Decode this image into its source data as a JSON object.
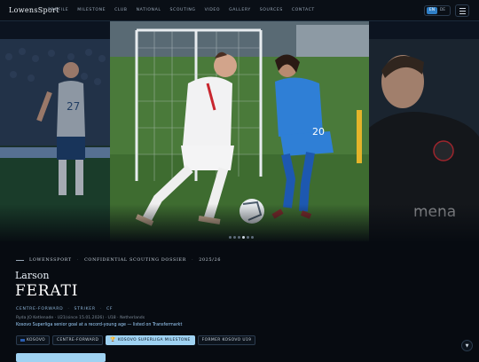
{
  "brand": {
    "logo_text": "LowensSport"
  },
  "nav": {
    "items": [
      "PROFILE",
      "MILESTONE",
      "CLUB",
      "NATIONAL",
      "SCOUTING",
      "VIDEO",
      "GALLERY",
      "SOURCES",
      "CONTACT"
    ],
    "lang_active": "EN",
    "lang_other": "DE"
  },
  "hero": {
    "slide_count": 6,
    "active_slide": 4
  },
  "dossier": {
    "brand": "LOWENSSPORT",
    "label": "CONFIDENTIAL SCOUTING DOSSIER",
    "season": "2025/26"
  },
  "player": {
    "first_name": "Larson",
    "last_name": "FERATI",
    "positions": [
      "CENTRE-FORWARD",
      "STRIKER",
      "CF"
    ],
    "meta": "Ryda JO Ketlenade · U21(since 15.01.2026) · U18 · Netherlands",
    "highlight": "Kosovo Superliga senior goal at a record-young age — listed on Transfermarkt"
  },
  "tags": [
    {
      "label": "KOSOVO",
      "icon": "flag-icon",
      "active": false
    },
    {
      "label": "CENTRE-FORWARD",
      "icon": "",
      "active": false
    },
    {
      "label": "KOSOVO SUPERLIGA MILESTONE",
      "icon": "trophy-icon",
      "active": true
    },
    {
      "label": "FORMER KOSOVO U19",
      "icon": "",
      "active": false
    }
  ],
  "colors": {
    "accent": "#9fd2f2",
    "background": "#070b11"
  }
}
